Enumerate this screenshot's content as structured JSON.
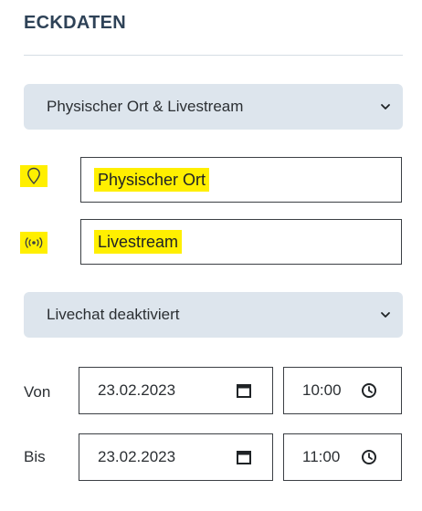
{
  "section": {
    "title": "ECKDATEN"
  },
  "location_select": {
    "value": "Physischer Ort & Livestream"
  },
  "fields": {
    "physical_location": "Physischer Ort",
    "livestream": "Livestream"
  },
  "chat_select": {
    "value": "Livechat deaktiviert"
  },
  "schedule": {
    "from_label": "Von",
    "from_date": "23.02.2023",
    "from_time": "10:00",
    "to_label": "Bis",
    "to_date": "23.02.2023",
    "to_time": "11:00"
  },
  "icons": {
    "location": "map-pin-icon",
    "livestream": "broadcast-icon",
    "calendar": "calendar-icon",
    "clock": "clock-icon",
    "dropdown": "chevron-down-icon"
  },
  "colors": {
    "highlight": "#ffef00",
    "select_background": "#dde5ed",
    "title": "#2e4257"
  }
}
